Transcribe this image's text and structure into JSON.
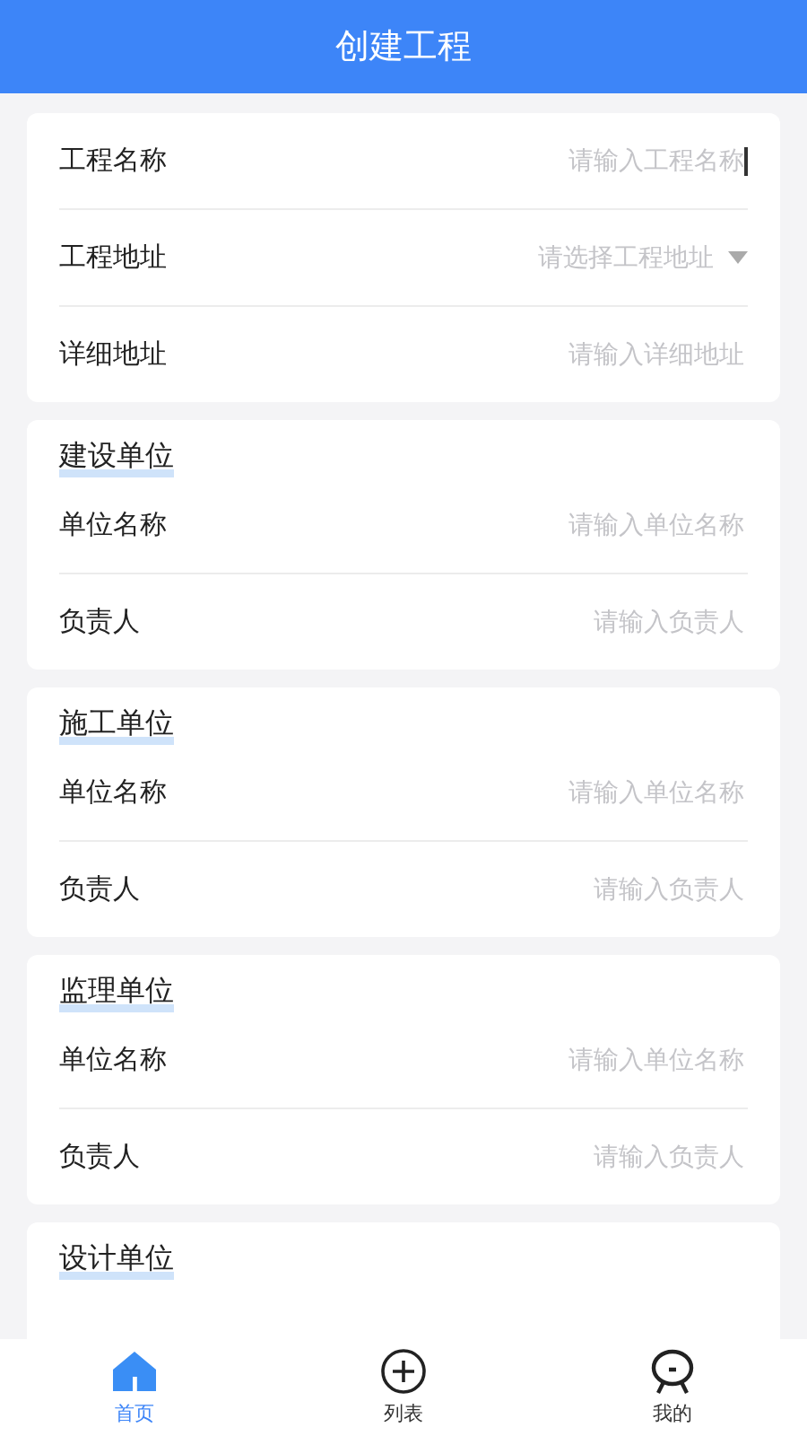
{
  "header": {
    "title": "创建工程"
  },
  "sections": [
    {
      "fields": [
        {
          "kind": "input",
          "label": "工程名称",
          "placeholder": "请输入工程名称",
          "focused": true
        },
        {
          "kind": "select",
          "label": "工程地址",
          "placeholder": "请选择工程地址",
          "focused": false
        },
        {
          "kind": "input",
          "label": "详细地址",
          "placeholder": "请输入详细地址",
          "focused": false
        }
      ]
    },
    {
      "title": "建设单位",
      "fields": [
        {
          "kind": "input",
          "label": "单位名称",
          "placeholder": "请输入单位名称",
          "focused": false
        },
        {
          "kind": "input",
          "label": "负责人",
          "placeholder": "请输入负责人",
          "focused": false
        }
      ]
    },
    {
      "title": "施工单位",
      "fields": [
        {
          "kind": "input",
          "label": "单位名称",
          "placeholder": "请输入单位名称",
          "focused": false
        },
        {
          "kind": "input",
          "label": "负责人",
          "placeholder": "请输入负责人",
          "focused": false
        }
      ]
    },
    {
      "title": "监理单位",
      "fields": [
        {
          "kind": "input",
          "label": "单位名称",
          "placeholder": "请输入单位名称",
          "focused": false
        },
        {
          "kind": "input",
          "label": "负责人",
          "placeholder": "请输入负责人",
          "focused": false
        }
      ]
    },
    {
      "title": "设计单位"
    }
  ],
  "tabbar": [
    {
      "kind": "home",
      "label": "首页",
      "selected": true
    },
    {
      "kind": "plus",
      "label": "列表",
      "selected": false
    },
    {
      "kind": "face",
      "label": "我的",
      "selected": false
    }
  ]
}
